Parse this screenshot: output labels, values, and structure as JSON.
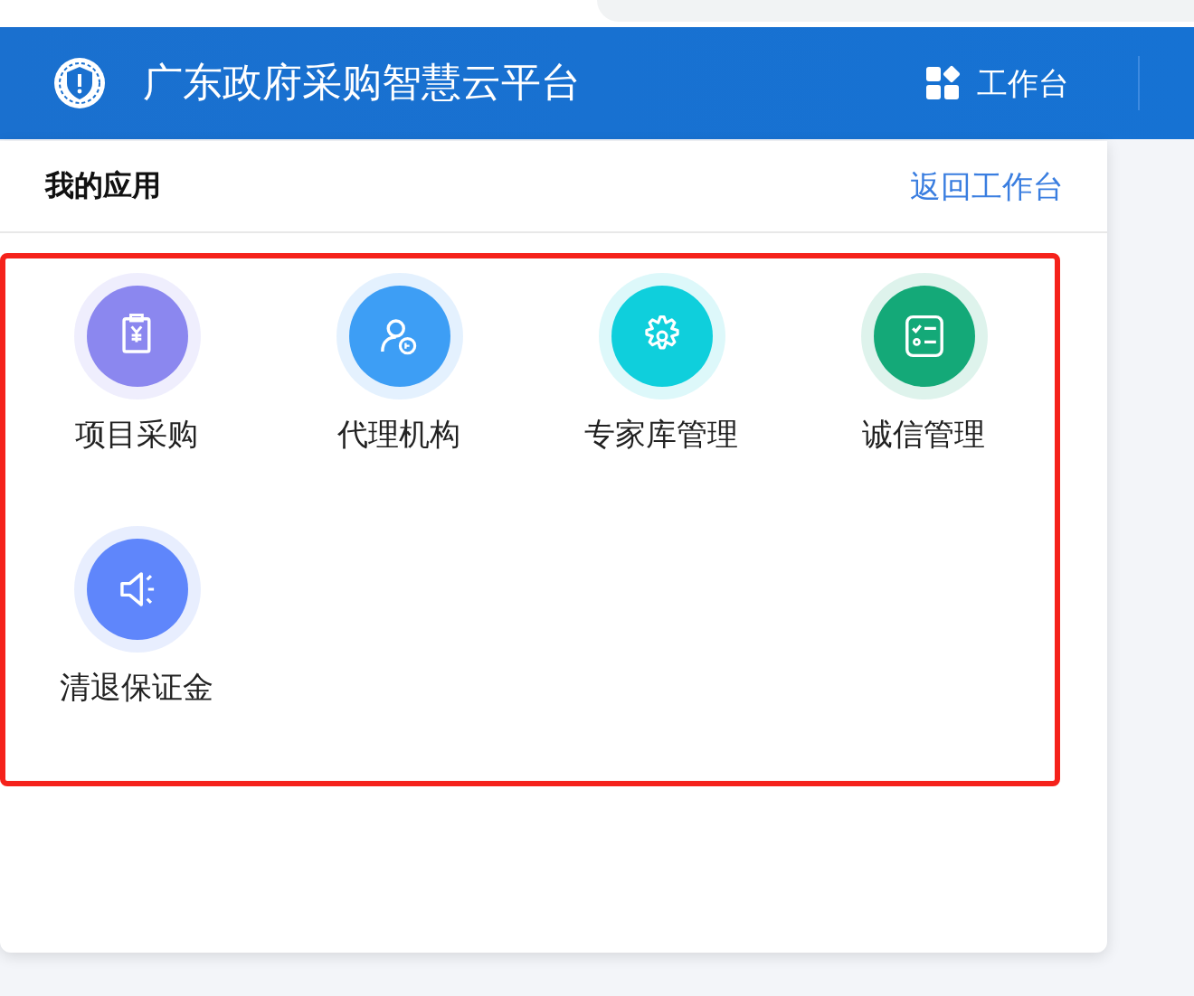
{
  "header": {
    "title": "广东政府采购智慧云平台",
    "nav": [
      {
        "label": "工作台"
      }
    ]
  },
  "panel": {
    "title": "我的应用",
    "back_link": "返回工作台",
    "apps": [
      {
        "label": "项目采购",
        "color": "#8b87ef"
      },
      {
        "label": "代理机构",
        "color": "#3d9ef5"
      },
      {
        "label": "专家库管理",
        "color": "#0fcfdc"
      },
      {
        "label": "诚信管理",
        "color": "#14a978"
      },
      {
        "label": "清退保证金",
        "color": "#5f86fb"
      }
    ]
  }
}
